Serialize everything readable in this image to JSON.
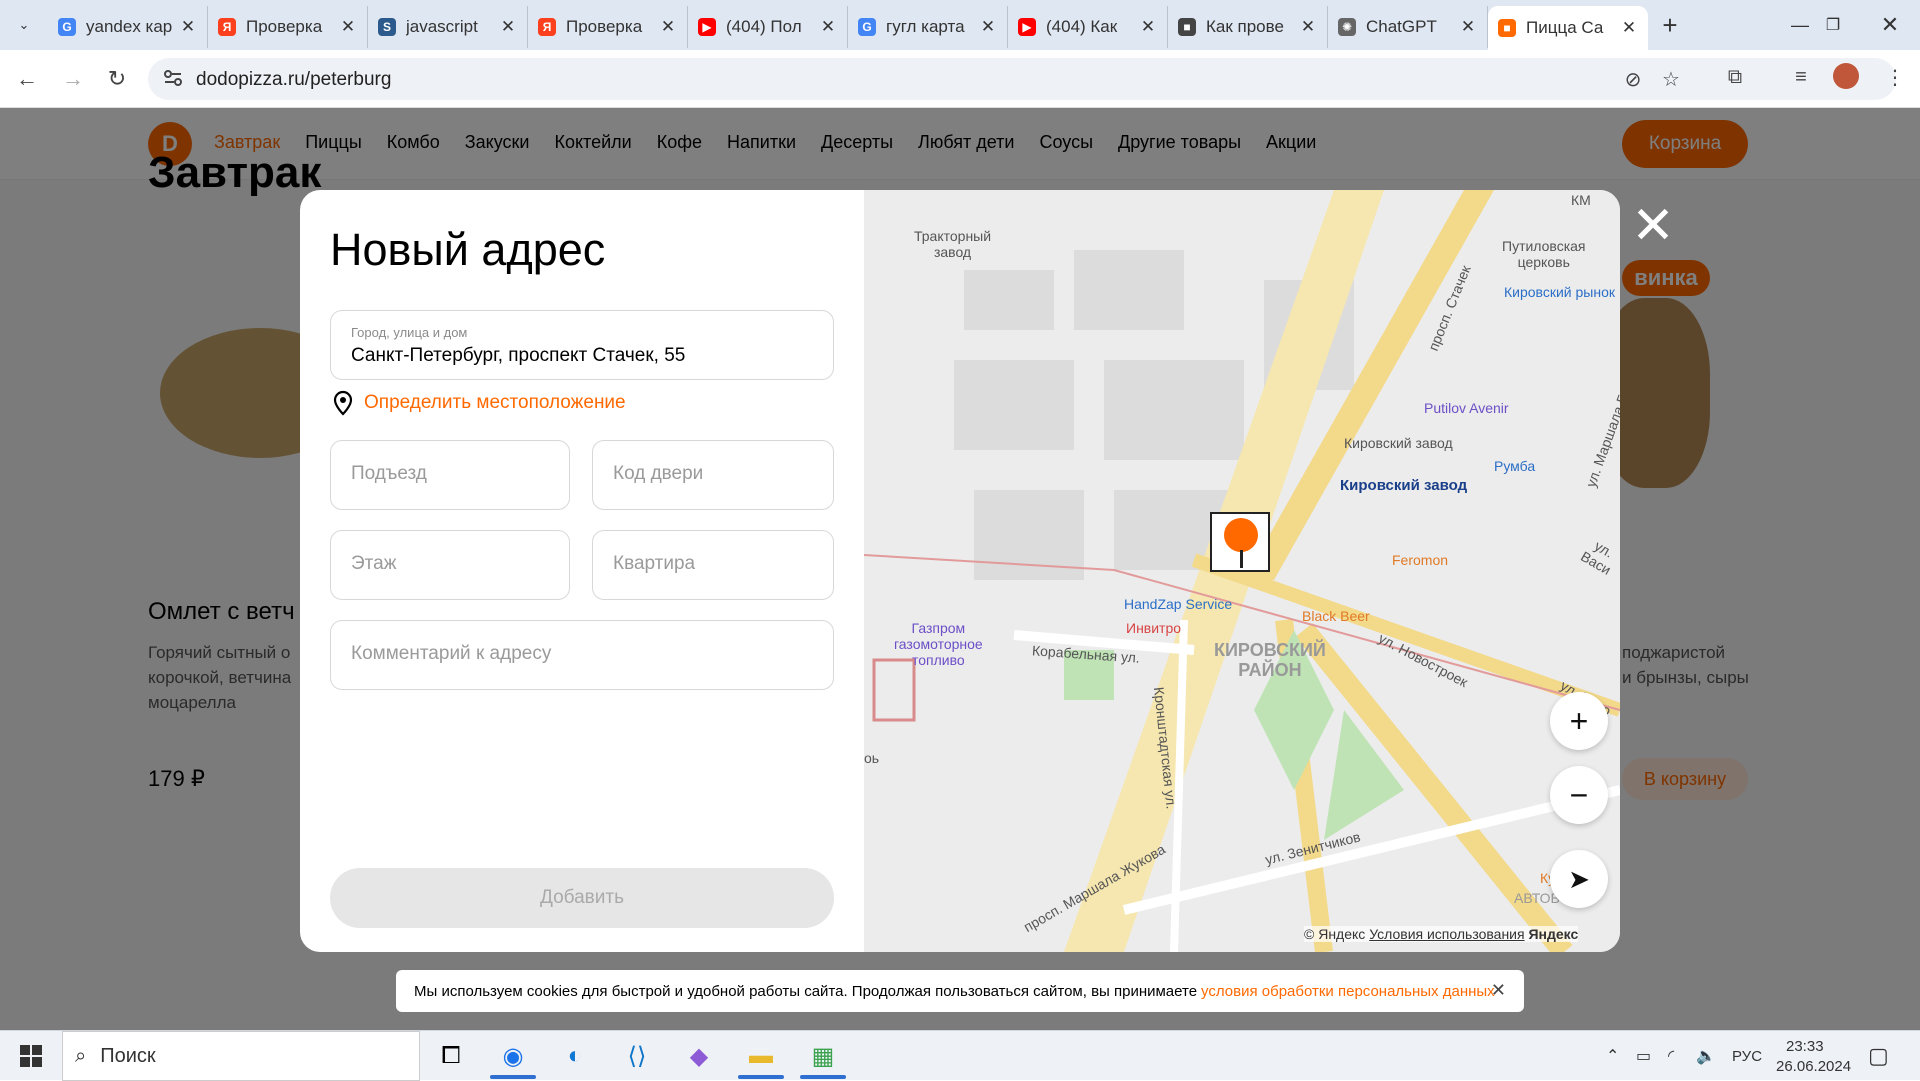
{
  "browser": {
    "tabs": [
      {
        "title": "yandex кар",
        "color": "#4285f4",
        "glyph": "G"
      },
      {
        "title": "Проверка",
        "color": "#fc3f1d",
        "glyph": "Я"
      },
      {
        "title": "javascript",
        "color": "#2d5a8c",
        "glyph": "S"
      },
      {
        "title": "Проверка",
        "color": "#fc3f1d",
        "glyph": "Я"
      },
      {
        "title": "(404) Пол",
        "color": "#ff0000",
        "glyph": "▶"
      },
      {
        "title": "гугл карта",
        "color": "#4285f4",
        "glyph": "G"
      },
      {
        "title": "(404) Как",
        "color": "#ff0000",
        "glyph": "▶"
      },
      {
        "title": "Как прове",
        "color": "#444",
        "glyph": "■"
      },
      {
        "title": "ChatGPT",
        "color": "#666",
        "glyph": "✺"
      },
      {
        "title": "Пицца Са",
        "color": "#ff6900",
        "glyph": "■",
        "active": true
      }
    ],
    "url": "dodopizza.ru/peterburg"
  },
  "site": {
    "menu": [
      "Завтрак",
      "Пиццы",
      "Комбо",
      "Закуски",
      "Коктейли",
      "Кофе",
      "Напитки",
      "Десерты",
      "Любят дети",
      "Соусы",
      "Другие товары",
      "Акции"
    ],
    "cart": "Корзина",
    "section": "Завтрак",
    "product_title": "Омлет с ветч",
    "product_desc": "Горячий сытный о\nкорочкой, ветчина\nмоцарелла",
    "product_price": "179 ₽",
    "right_desc": "поджаристой\nи брынзы, сыры",
    "right_button": "В корзину",
    "right_badge": "винка"
  },
  "modal": {
    "title": "Новый адрес",
    "address_label": "Город, улица и дом",
    "address_value": "Санкт-Петербург, проспект Стачек, 55",
    "locate": "Определить местоположение",
    "entrance": "Подъезд",
    "door_code": "Код двери",
    "floor": "Этаж",
    "apartment": "Квартира",
    "comment": "Комментарий к адресу",
    "submit": "Добавить"
  },
  "map": {
    "labels": {
      "tractor": "Тракторный\nзавод",
      "church": "Путиловская\nцерковь",
      "kirov_market": "Кировский рынок",
      "avenir": "Putilov Avenir",
      "kirov_plant": "Кировский завод",
      "metro": "Кировский завод",
      "rumba": "Румба",
      "feromon": "Feromon",
      "handzap": "HandZap Service",
      "blackbeer": "Black Beer",
      "invitro": "Инвитро",
      "gazprom": "Газпром\nгазомоторное\nтопливо",
      "district": "КИРОВСКИЙ\nРАЙОН",
      "korabelnaya": "Корабельная ул.",
      "stachek": "просп. Стачек",
      "novostroek": "ул. Новостроек",
      "zenitchikov": "ул. Зенитчиков",
      "zhukova": "просп. Маршала Жукова",
      "kronshtadt": "Кронштадтская ул.",
      "avtovo": "АВТОВО",
      "kuz": "Куз",
      "km": "КМ",
      "marshala": "ул. Маршала Го",
      "vasi": "ул. Васи",
      "novo": "ул. Ново",
      "of": "оь"
    },
    "copyright": "© Яндекс",
    "terms": "Условия использования",
    "brand": "Яндекс"
  },
  "cookie": {
    "text": "Мы используем cookies для быстрой и удобной работы сайта. Продолжая пользоваться сайтом, вы принимаете",
    "link": "условия обработки персональных данных"
  },
  "taskbar": {
    "search": "Поиск",
    "lang": "РУС",
    "time": "23:33",
    "date": "26.06.2024"
  },
  "colors": {
    "brand": "#ff6900",
    "tab_bg": "#dfe7f2"
  }
}
